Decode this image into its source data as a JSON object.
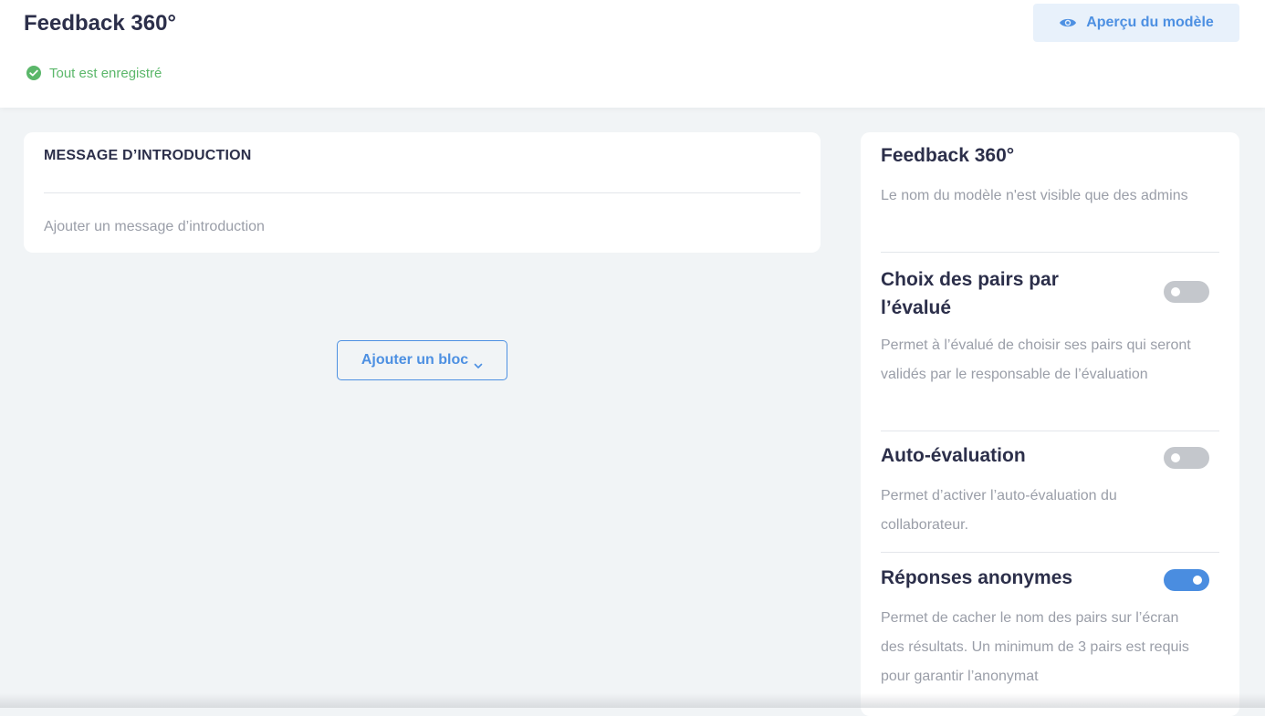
{
  "header": {
    "title": "Feedback 360°",
    "save_status": "Tout est enregistré",
    "preview_label": "Aperçu du modèle"
  },
  "intro": {
    "title": "MESSAGE D’INTRODUCTION",
    "placeholder": "Ajouter un message d’introduction"
  },
  "add_block_label": "Ajouter un bloc",
  "panel": {
    "title": "Feedback 360°",
    "title_note": "Le nom du modèle n'est visible que des admins",
    "options": [
      {
        "title": "Choix des pairs par l’évalué",
        "description": "Permet à l’évalué de choisir ses pairs qui seront validés par le responsable de l’évaluation",
        "enabled": false
      },
      {
        "title": "Auto-évaluation",
        "description": "Permet d’activer l’auto-évaluation du collaborateur.",
        "enabled": false
      },
      {
        "title": "Réponses anonymes",
        "description": "Permet de cacher le nom des pairs sur l’écran des résultats. Un minimum de 3 pairs est requis pour garantir l’anonymat",
        "enabled": true
      }
    ]
  },
  "colors": {
    "accent": "#4d90e2",
    "success": "#5bb76a",
    "toggle_off": "#c4c7cc",
    "toggle_on": "#4a8de0"
  }
}
